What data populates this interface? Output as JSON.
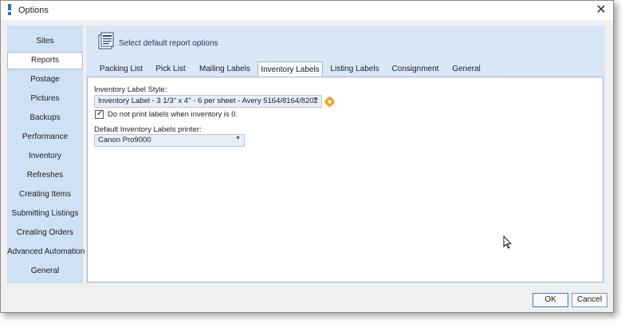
{
  "window": {
    "title": "Options",
    "close_glyph": "✕"
  },
  "sidebar": {
    "items": [
      {
        "label": "Sites"
      },
      {
        "label": "Reports",
        "active": true
      },
      {
        "label": "Postage"
      },
      {
        "label": "Pictures"
      },
      {
        "label": "Backups"
      },
      {
        "label": "Performance"
      },
      {
        "label": "Inventory"
      },
      {
        "label": "Refreshes"
      },
      {
        "label": "Creating Items"
      },
      {
        "label": "Submitting Listings"
      },
      {
        "label": "Creating Orders"
      },
      {
        "label": "Advanced Automation"
      },
      {
        "label": "General"
      }
    ]
  },
  "header": {
    "text": "Select default report options",
    "icon": "report-document-icon"
  },
  "tabs": [
    {
      "label": "Packing List"
    },
    {
      "label": "Pick List"
    },
    {
      "label": "Mailing Labels"
    },
    {
      "label": "Inventory Labels",
      "active": true
    },
    {
      "label": "Listing Labels"
    },
    {
      "label": "Consignment"
    },
    {
      "label": "General"
    }
  ],
  "form": {
    "style_label": "Inventory Label Style:",
    "style_value": "Inventory Label - 3 1/3\" x 4\" - 6 per sheet - Avery 5164/8164/8202",
    "checkbox_label": "Do not print labels when inventory is 0.",
    "checkbox_checked": true,
    "printer_label": "Default Inventory Labels printer:",
    "printer_value": "Canon Pro9000"
  },
  "buttons": {
    "ok": "OK",
    "cancel": "Cancel"
  },
  "colors": {
    "sidebar_bg": "#cfe1f4",
    "panel_bg": "#d9e7f6",
    "gear_icon": "#f2a01c"
  }
}
